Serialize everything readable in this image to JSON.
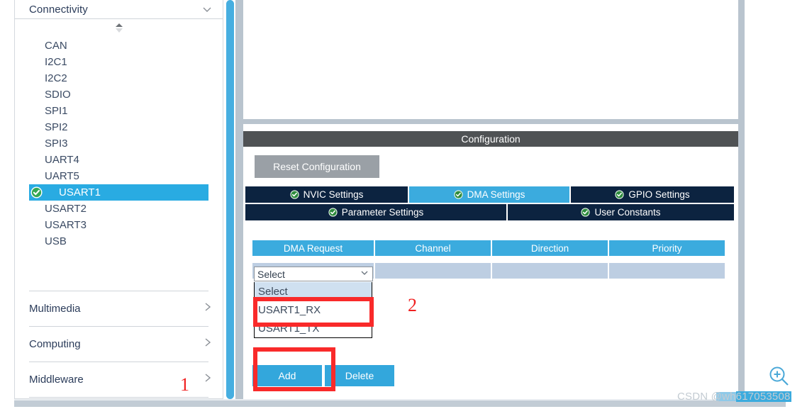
{
  "sidebar": {
    "group": {
      "label": "Connectivity",
      "icon": "chevron-down-icon"
    },
    "scroll_spinner_icon": "scroll-updown-icon",
    "peripherals": [
      {
        "label": "CAN",
        "selected": false,
        "configured": false
      },
      {
        "label": "I2C1",
        "selected": false,
        "configured": false
      },
      {
        "label": "I2C2",
        "selected": false,
        "configured": false
      },
      {
        "label": "SDIO",
        "selected": false,
        "configured": false
      },
      {
        "label": "SPI1",
        "selected": false,
        "configured": false
      },
      {
        "label": "SPI2",
        "selected": false,
        "configured": false
      },
      {
        "label": "SPI3",
        "selected": false,
        "configured": false
      },
      {
        "label": "UART4",
        "selected": false,
        "configured": false
      },
      {
        "label": "UART5",
        "selected": false,
        "configured": false
      },
      {
        "label": "USART1",
        "selected": true,
        "configured": true
      },
      {
        "label": "USART2",
        "selected": false,
        "configured": false
      },
      {
        "label": "USART3",
        "selected": false,
        "configured": false
      },
      {
        "label": "USB",
        "selected": false,
        "configured": false
      }
    ],
    "categories": [
      {
        "label": "Multimedia",
        "icon": "chevron-right-icon"
      },
      {
        "label": "Computing",
        "icon": "chevron-right-icon"
      },
      {
        "label": "Middleware",
        "icon": "chevron-right-icon"
      }
    ]
  },
  "config": {
    "title": "Configuration",
    "reset_label": "Reset Configuration",
    "tabs_row1": [
      {
        "label": "NVIC Settings",
        "active": false,
        "icon": "check-circle-icon"
      },
      {
        "label": "DMA Settings",
        "active": true,
        "icon": "check-circle-icon"
      },
      {
        "label": "GPIO Settings",
        "active": false,
        "icon": "check-circle-icon"
      }
    ],
    "tabs_row2": [
      {
        "label": "Parameter Settings",
        "active": false,
        "icon": "check-circle-icon"
      },
      {
        "label": "User Constants",
        "active": false,
        "icon": "check-circle-icon"
      }
    ],
    "table": {
      "columns": [
        "DMA Request",
        "Channel",
        "Direction",
        "Priority"
      ],
      "rows": [
        {
          "dma_request": "",
          "channel": "",
          "direction": "",
          "priority": ""
        }
      ]
    },
    "dropdown": {
      "value": "Select",
      "caret_icon": "chevron-down-icon",
      "open": true,
      "options": [
        "Select",
        "USART1_RX",
        "USART1_TX"
      ],
      "highlighted": "Select"
    },
    "buttons": {
      "add": "Add",
      "delete": "Delete"
    }
  },
  "annotations": {
    "marker_one": "1",
    "marker_two": "2"
  },
  "overlay": {
    "zoom_in_icon": "zoom-in-magnifier-icon",
    "watermark": "CSDN @wh617053508"
  },
  "colors": {
    "accent_blue": "#3BABDE",
    "tab_navy": "#0c2340",
    "selection_blue": "#29ABE2",
    "row_blue": "#bdcee2",
    "config_bar_gray": "#4f5254",
    "reset_gray": "#9aa0a6",
    "annotation_red": "#f92a2a",
    "check_green": "#3aa63a"
  }
}
